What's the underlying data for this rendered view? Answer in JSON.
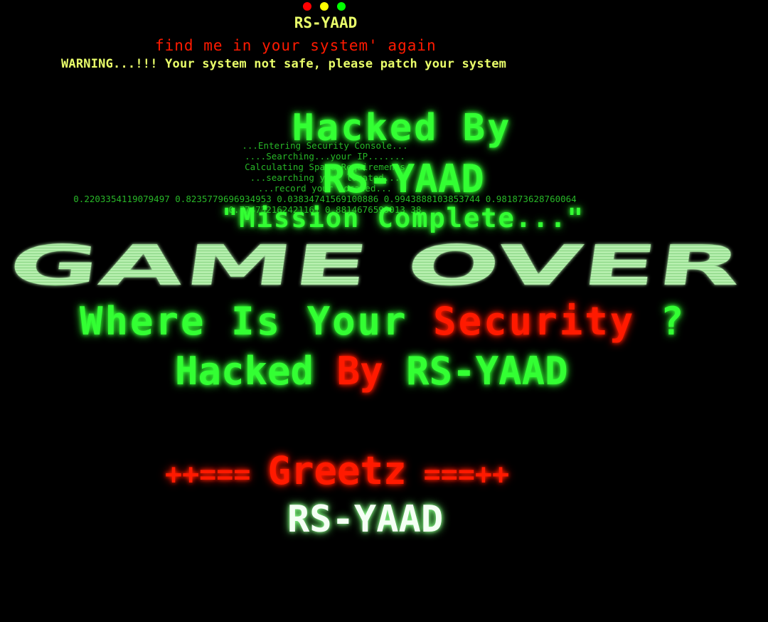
{
  "colors": {
    "dot_red": "#ff0000",
    "dot_yellow": "#ffff00",
    "dot_green": "#00ff00",
    "yellow": "#eaff6a",
    "red": "#ff1a00",
    "green": "#33ff33",
    "light_green": "#b8f0b0",
    "white": "#f4fff4",
    "console_green": "#2fd62f"
  },
  "header": {
    "title": "RS-YAAD",
    "find_me": "find me in your system' again",
    "warning": "WARNING...!!! Your system not safe, please patch your system"
  },
  "console": {
    "lines": [
      "...Entering Security Console...",
      "....Searching...your IP.......",
      "Calculating Space Requirements",
      "...searching your located...",
      "...record your located...",
      "0.2203354119079497 0.8235779696934953 0.03834741569100886 0.9943888103853744 0.981873628760064",
      "0.774732162421161 0.8814676599013 38"
    ]
  },
  "main": {
    "hacked_by": "Hacked By",
    "name": "RS-YAAD",
    "mission": "\"Mission Complete...\"",
    "game_over": "GAME OVER",
    "where_prefix": "Where Is Your ",
    "where_highlight": "Security",
    "where_suffix": " ?",
    "hacked_word": "Hacked ",
    "by_word": "By",
    "hacked_name": " RS-YAAD",
    "greetz_left": "++=== ",
    "greetz_word": "Greetz",
    "greetz_right": " ===++",
    "final_name": "RS-YAAD"
  }
}
